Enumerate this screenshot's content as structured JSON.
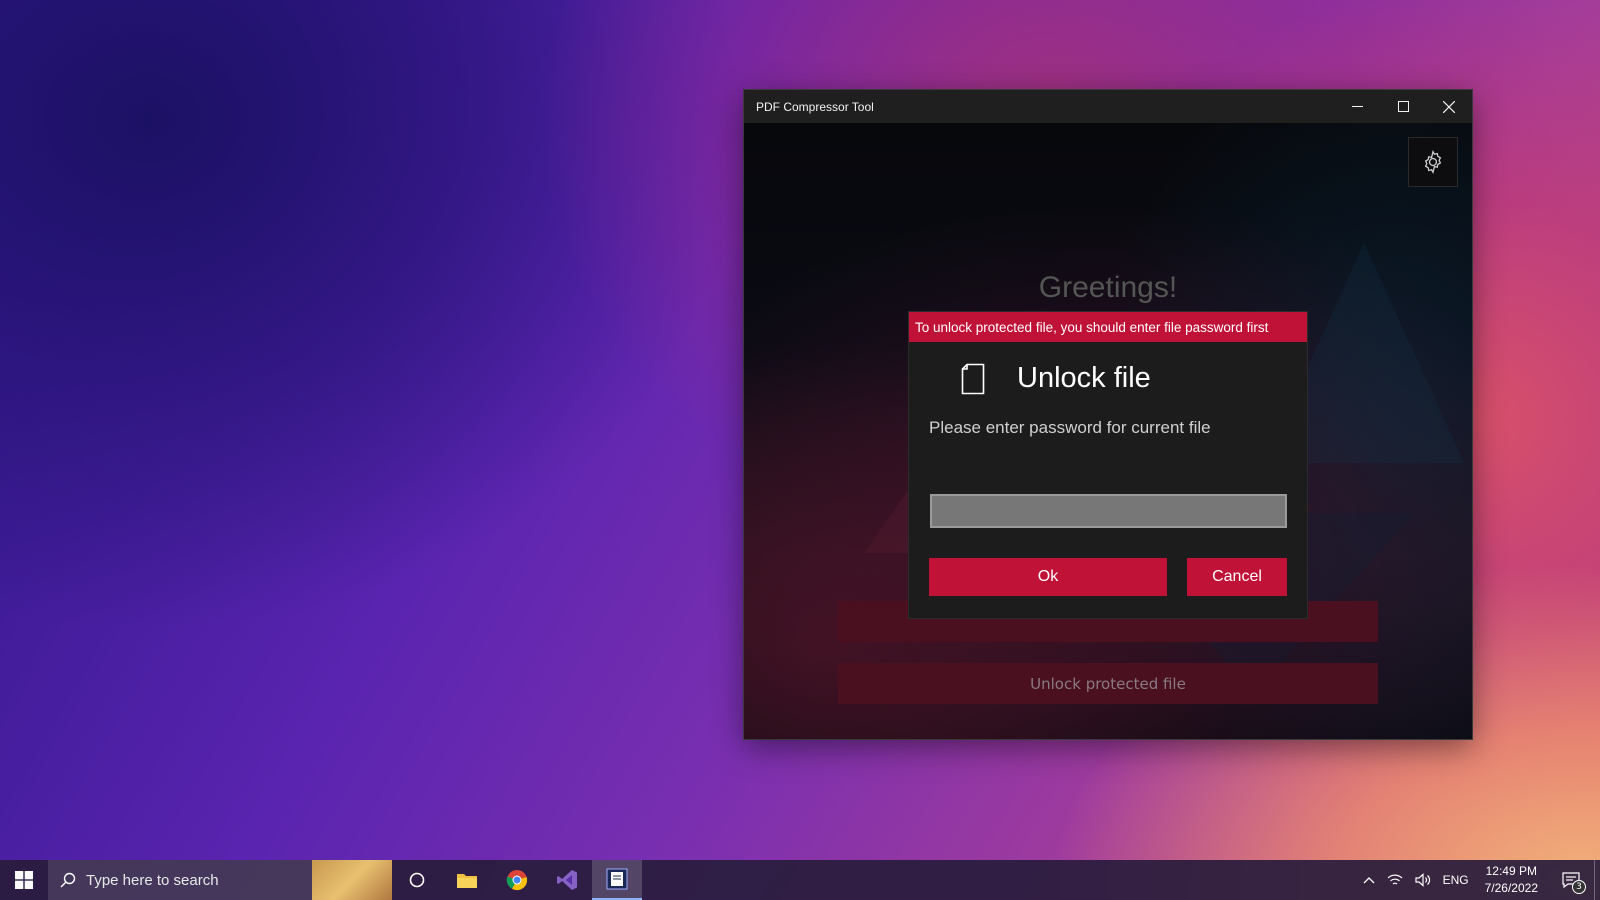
{
  "window": {
    "title": "PDF Compressor Tool"
  },
  "app": {
    "greeting": "Greetings!",
    "background_button_1": "",
    "background_button_2": "Unlock protected file"
  },
  "dialog": {
    "banner": "To unlock protected file, you should enter file password first",
    "title": "Unlock file",
    "subtitle": "Please enter password for current file",
    "password_value": "",
    "ok_label": "Ok",
    "cancel_label": "Cancel"
  },
  "taskbar": {
    "search_placeholder": "Type here to search",
    "language": "ENG",
    "time": "12:49 PM",
    "date": "7/26/2022",
    "notification_count": "3"
  },
  "colors": {
    "accent": "#c01237",
    "titlebar": "#1f1f1f",
    "dialog_bg": "#1c1c1c"
  }
}
